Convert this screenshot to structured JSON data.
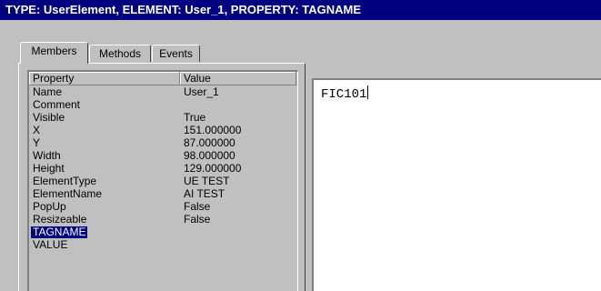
{
  "window": {
    "title": "TYPE: UserElement,  ELEMENT: User_1,  PROPERTY: TAGNAME"
  },
  "tabs": [
    {
      "label": "Members",
      "active": true
    },
    {
      "label": "Methods",
      "active": false
    },
    {
      "label": "Events",
      "active": false
    }
  ],
  "grid": {
    "columns": [
      "Property",
      "Value"
    ],
    "rows": [
      {
        "property": "Name",
        "value": "User_1"
      },
      {
        "property": "Comment",
        "value": ""
      },
      {
        "property": "Visible",
        "value": "True"
      },
      {
        "property": "X",
        "value": "151.000000"
      },
      {
        "property": "Y",
        "value": "87.000000"
      },
      {
        "property": "Width",
        "value": "98.000000"
      },
      {
        "property": "Height",
        "value": "129.000000"
      },
      {
        "property": "ElementType",
        "value": "UE TEST"
      },
      {
        "property": "ElementName",
        "value": "AI TEST"
      },
      {
        "property": "PopUp",
        "value": "False"
      },
      {
        "property": "Resizeable",
        "value": "False"
      },
      {
        "property": "TAGNAME",
        "value": "",
        "selected": true
      },
      {
        "property": "VALUE",
        "value": ""
      }
    ]
  },
  "editor": {
    "value": "FIC101"
  },
  "colors": {
    "titlebar": "#000080",
    "selection": "#000080",
    "window_bg": "#c0c0c0"
  }
}
